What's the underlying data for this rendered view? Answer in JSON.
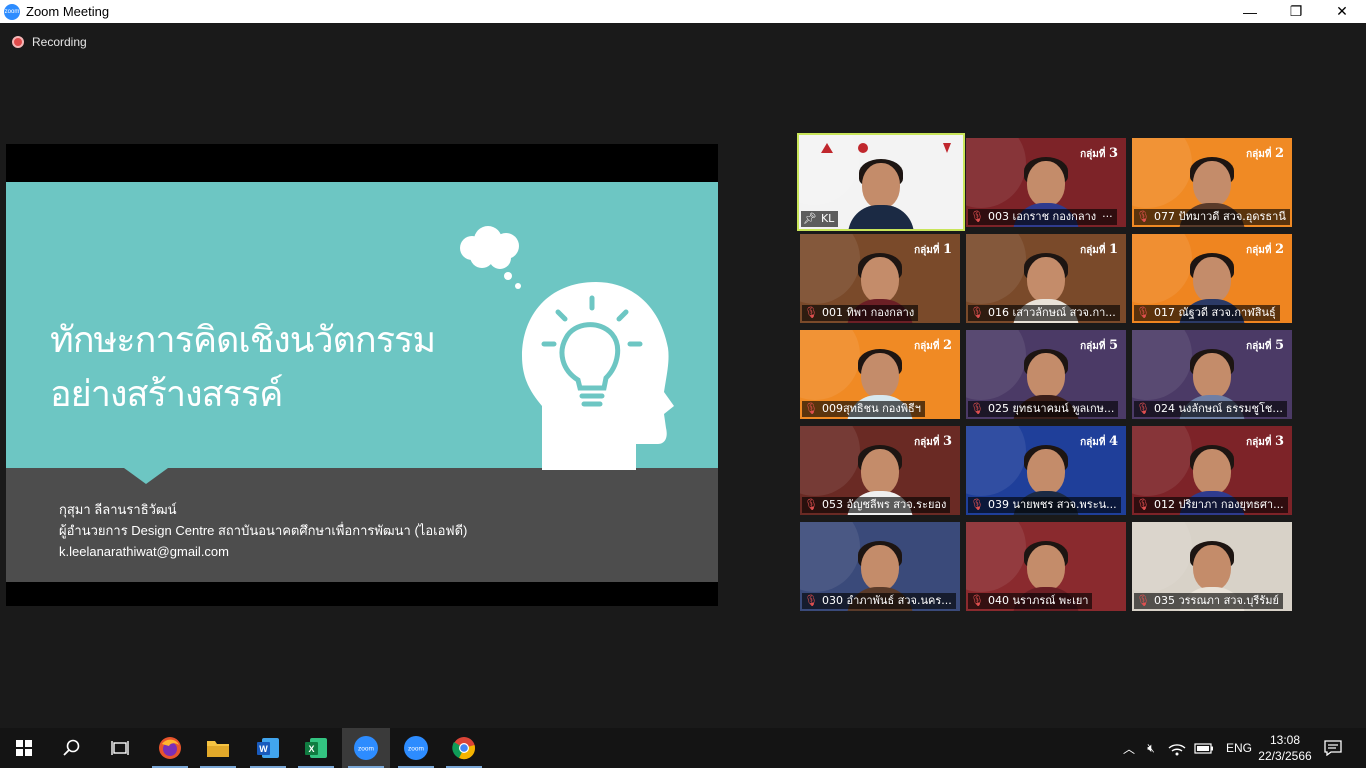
{
  "window": {
    "title": "Zoom Meeting",
    "minimize": "—",
    "restore": "❐",
    "close": "✕"
  },
  "recording": {
    "label": "Recording"
  },
  "slide": {
    "title_line1": "ทักษะการคิดเชิงนวัตกรรม",
    "title_line2": "อย่างสร้างสรรค์",
    "presenter_name": "กุสุมา ลีลานราธิวัฒน์",
    "presenter_role": "ผู้อำนวยการ Design Centre สถาบันอนาคตศึกษาเพื่อการพัฒนา (ไอเอฟดี)",
    "presenter_email": "k.leelanarathiwat@gmail.com"
  },
  "colors": {
    "slide_teal": "#6dc6c3",
    "slide_gray": "#4d4d4d",
    "active_border": "#c9e55a",
    "group_red": "#7d2328",
    "group_orange": "#f08a24",
    "group_purple": "#4b3a66",
    "group_blue": "#1f3f9a"
  },
  "participants": [
    {
      "name": "KL",
      "group_prefix": "",
      "group_num": "",
      "pinned": true,
      "bg": "#f3f3f3"
    },
    {
      "name": "003 เอกราช กองกลาง",
      "group_prefix": "กลุ่มที่",
      "group_num": "3",
      "bg": "#7d2328",
      "more": "···"
    },
    {
      "name": "077 ปัทมาวดี สวจ.อุดรธานี",
      "group_prefix": "กลุ่มที่",
      "group_num": "2",
      "bg": "#f08a24"
    },
    {
      "name": "001 ทิพา กองกลาง",
      "group_prefix": "กลุ่มที่",
      "group_num": "1",
      "bg": "#7a4a2a"
    },
    {
      "name": "016 เสาวลักษณ์ สวจ.กา...",
      "group_prefix": "กลุ่มที่",
      "group_num": "1",
      "bg": "#7a4a2a"
    },
    {
      "name": "017 ณัฐวดี สวจ.กาฬสินธุ์",
      "group_prefix": "กลุ่มที่",
      "group_num": "2",
      "bg": "#ef8520"
    },
    {
      "name": "009สุทธิชน กองพิธีฯ",
      "group_prefix": "กลุ่มที่",
      "group_num": "2",
      "bg": "#f08a24"
    },
    {
      "name": "025 ยุทธนาคมน์ พูลเกษ...",
      "group_prefix": "กลุ่มที่",
      "group_num": "5",
      "bg": "#4b3a66"
    },
    {
      "name": "024 นงลักษณ์ ธรรมชูโช...",
      "group_prefix": "กลุ่มที่",
      "group_num": "5",
      "bg": "#4b3a66"
    },
    {
      "name": "053 อัญชลีพร สวจ.ระยอง",
      "group_prefix": "กลุ่มที่",
      "group_num": "3",
      "bg": "#6a2a24"
    },
    {
      "name": "039 นายพชร สวจ.พระน...",
      "group_prefix": "กลุ่มที่",
      "group_num": "4",
      "bg": "#1f3f9a"
    },
    {
      "name": "012 ปริยาภา กองยุทธศา...",
      "group_prefix": "กลุ่มที่",
      "group_num": "3",
      "bg": "#7d2328"
    },
    {
      "name": "030 อำภาพันธ์ สวจ.นคร...",
      "group_prefix": "",
      "group_num": "",
      "bg": "#3a4a7a"
    },
    {
      "name": "040 นราภรณ์ พะเยา",
      "group_prefix": "",
      "group_num": "",
      "bg": "#8a2a2e"
    },
    {
      "name": "035 วรรณภา สวจ.บุรีรัมย์",
      "group_prefix": "",
      "group_num": "",
      "bg": "#d8d2c8"
    }
  ],
  "taskbar": {
    "apps": [
      "start",
      "search",
      "task-view",
      "firefox",
      "file-explorer",
      "word",
      "excel",
      "zoom",
      "zoom",
      "chrome"
    ],
    "zoom_label": "zoom",
    "language": "ENG",
    "time": "13:08",
    "date": "22/3/2566"
  }
}
